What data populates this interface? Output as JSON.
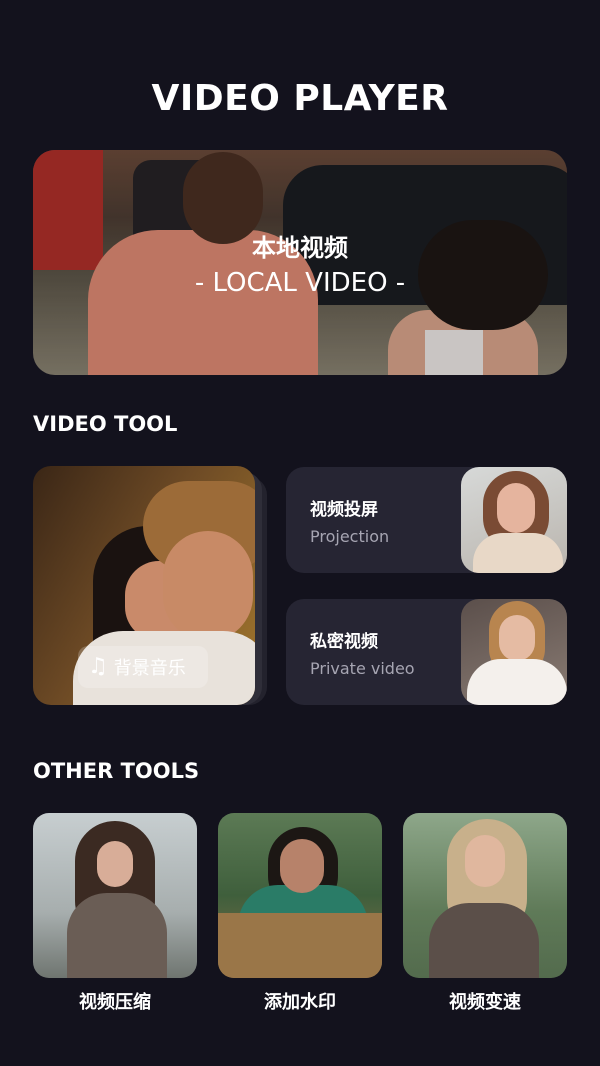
{
  "header": {
    "title": "VIDEO PLAYER"
  },
  "hero": {
    "title_cn": "本地视频",
    "title_en": "- LOCAL VIDEO -"
  },
  "video_tool": {
    "heading": "VIDEO TOOL",
    "background_music": {
      "label": "背景音乐",
      "icon": "music-note-icon"
    },
    "cards": [
      {
        "title_cn": "视频投屏",
        "subtitle_en": "Projection"
      },
      {
        "title_cn": "私密视频",
        "subtitle_en": "Private video"
      }
    ]
  },
  "other_tools": {
    "heading": "OTHER TOOLS",
    "items": [
      {
        "label": "视频压缩"
      },
      {
        "label": "添加水印"
      },
      {
        "label": "视频变速"
      }
    ]
  },
  "colors": {
    "background": "#13121d",
    "card": "#262533",
    "text": "#ffffff",
    "muted_text": "#a6a5b2"
  }
}
